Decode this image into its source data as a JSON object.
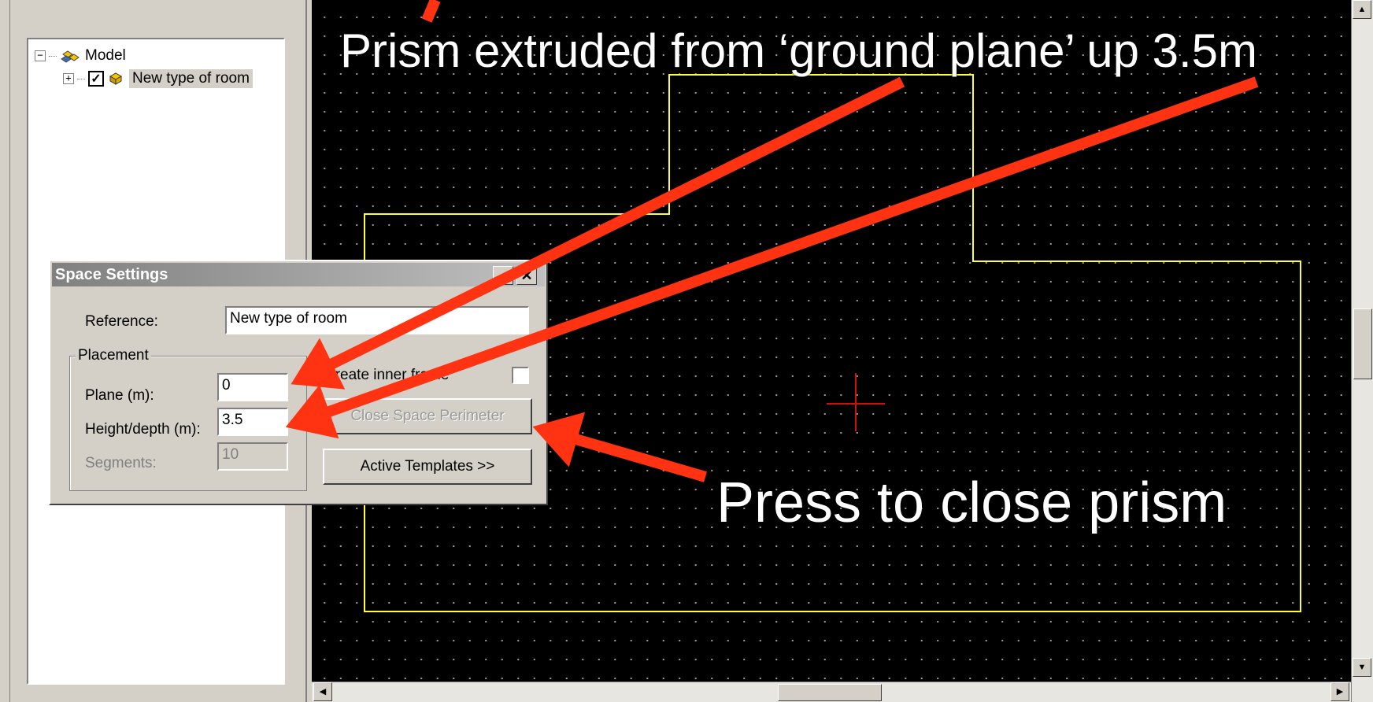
{
  "tree": {
    "root_label": "Model",
    "root_expander": "−",
    "child_label": "New type of room",
    "child_expander": "+",
    "child_checked": "✓"
  },
  "dialog": {
    "title": "Space Settings",
    "minimize_glyph": "_",
    "close_glyph": "✕",
    "reference_label": "Reference:",
    "reference_value": "New type of room",
    "placement_group": "Placement",
    "plane_label": "Plane (m):",
    "plane_value": "0",
    "height_label": "Height/depth (m):",
    "height_value": "3.5",
    "segments_label": "Segments:",
    "segments_value": "10",
    "inner_frame_label": "Create inner frame",
    "close_perimeter_button": "Close Space Perimeter",
    "active_templates_button": "Active Templates >>"
  },
  "scrollbars": {
    "up_arrow": "▲",
    "down_arrow": "▼",
    "left_arrow": "◀",
    "right_arrow": "▶"
  },
  "annotations": {
    "top_callout": "Prism extruded from ‘ground plane’ up 3.5m",
    "bottom_callout": "Press to close prism"
  },
  "colors": {
    "canvas_bg": "#000000",
    "outline": "#ffff33",
    "crosshair": "#cc1010",
    "arrow": "#ff3311"
  }
}
